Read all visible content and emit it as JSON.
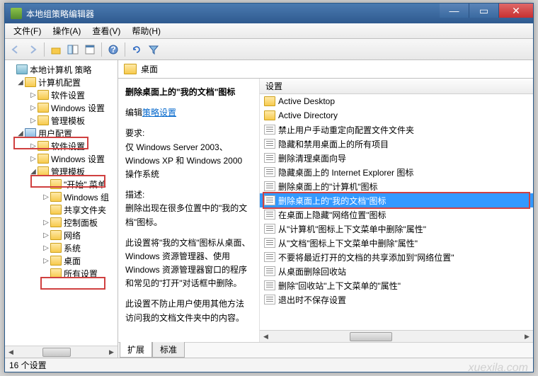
{
  "window": {
    "title": "本地组策略编辑器"
  },
  "menu": {
    "file": "文件(F)",
    "action": "操作(A)",
    "view": "查看(V)",
    "help": "帮助(H)"
  },
  "tree": {
    "root": "本地计算机 策略",
    "computer": "计算机配置",
    "c_soft": "软件设置",
    "c_win": "Windows 设置",
    "c_admin": "管理模板",
    "user": "用户配置",
    "u_soft": "软件设置",
    "u_win": "Windows 设置",
    "u_admin": "管理模板",
    "start": "\"开始\" 菜单",
    "wincomp": "Windows 组",
    "shared": "共享文件夹",
    "ctrl": "控制面板",
    "net": "网络",
    "sys": "系统",
    "desktop": "桌面",
    "all": "所有设置"
  },
  "crumb": {
    "label": "桌面"
  },
  "desc": {
    "heading": "删除桌面上的\"我的文档\"图标",
    "edit_prefix": "编辑",
    "edit_link": "策略设置",
    "req_label": "要求:",
    "req_text": "仅 Windows Server 2003、Windows XP 和 Windows 2000 操作系统",
    "d_label": "描述:",
    "d1": "删除出现在很多位置中的\"我的文档\"图标。",
    "d2": "此设置将\"我的文档\"图标从桌面、Windows 资源管理器、使用 Windows 资源管理器窗口的程序和常见的\"打开\"对话框中删除。",
    "d3": "此设置不防止用户使用其他方法访问我的文档文件夹中的内容。"
  },
  "list": {
    "header": "设置",
    "items": [
      {
        "t": "folder",
        "l": "Active Desktop"
      },
      {
        "t": "folder",
        "l": "Active Directory"
      },
      {
        "t": "setting",
        "l": "禁止用户手动重定向配置文件文件夹"
      },
      {
        "t": "setting",
        "l": "隐藏和禁用桌面上的所有项目"
      },
      {
        "t": "setting",
        "l": "删除清理桌面向导"
      },
      {
        "t": "setting",
        "l": "隐藏桌面上的 Internet Explorer 图标"
      },
      {
        "t": "setting",
        "l": "删除桌面上的\"计算机\"图标"
      },
      {
        "t": "setting",
        "l": "删除桌面上的\"我的文档\"图标",
        "sel": true
      },
      {
        "t": "setting",
        "l": "在桌面上隐藏\"网络位置\"图标"
      },
      {
        "t": "setting",
        "l": "从\"计算机\"图标上下文菜单中删除\"属性\""
      },
      {
        "t": "setting",
        "l": "从\"文档\"图标上下文菜单中删除\"属性\""
      },
      {
        "t": "setting",
        "l": "不要将最近打开的文档的共享添加到\"网络位置\""
      },
      {
        "t": "setting",
        "l": "从桌面删除回收站"
      },
      {
        "t": "setting",
        "l": "删除\"回收站\"上下文菜单的\"属性\""
      },
      {
        "t": "setting",
        "l": "退出时不保存设置"
      }
    ]
  },
  "tabs": {
    "ext": "扩展",
    "std": "标准"
  },
  "status": {
    "text": "16 个设置"
  },
  "watermark": "xuexila.com"
}
